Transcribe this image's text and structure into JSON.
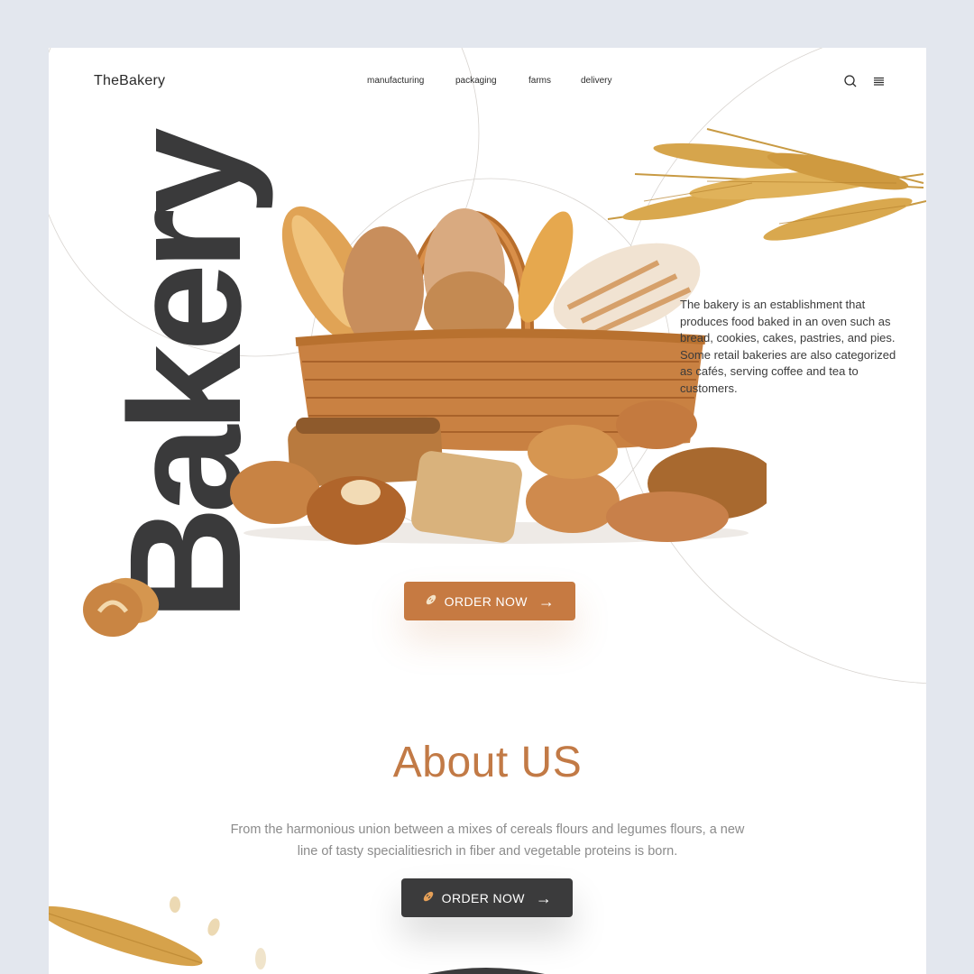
{
  "brand": {
    "logo": "TheBakery"
  },
  "nav": {
    "items": [
      {
        "label": "manufacturing"
      },
      {
        "label": "packaging"
      },
      {
        "label": "farms"
      },
      {
        "label": "delivery"
      }
    ]
  },
  "header_icons": {
    "search": "search-icon",
    "menu": "menu-icon"
  },
  "hero": {
    "big_word": "Bakery",
    "description": "The bakery is an establishment that produces food baked in an oven such as bread, cookies, cakes, pastries, and pies. Some retail bakeries are also categorized as cafés, serving coffee and tea to customers.",
    "cta_label": "ORDER NOW",
    "cta_icon": "bread-icon",
    "cta_arrow": "→"
  },
  "about": {
    "title": "About US",
    "text": "From the harmonious union between a mixes of cereals flours and legumes flours, a new line of tasty specialitiesrich in fiber and vegetable proteins is born.",
    "cta_label": "ORDER NOW",
    "cta_icon": "bread-icon",
    "cta_arrow": "→"
  },
  "colors": {
    "page_bg": "#e3e7ee",
    "card_bg": "#ffffff",
    "accent": "#c67a42",
    "dark": "#3b3b3c",
    "title_accent": "#c27a46"
  }
}
